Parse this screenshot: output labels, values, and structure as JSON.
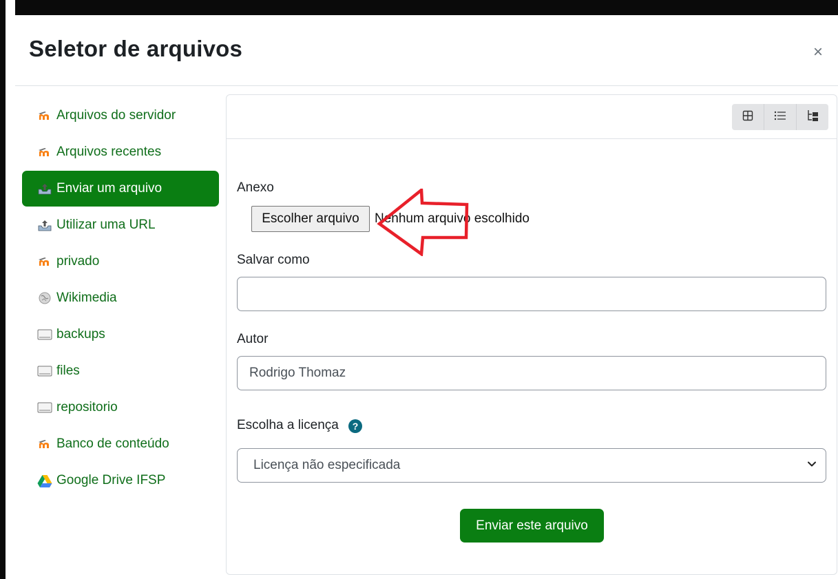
{
  "modal": {
    "title": "Seletor de arquivos",
    "close_label": "×"
  },
  "sidebar": {
    "items": [
      {
        "label": "Arquivos do servidor",
        "icon": "moodle-icon",
        "active": false
      },
      {
        "label": "Arquivos recentes",
        "icon": "moodle-icon",
        "active": false
      },
      {
        "label": "Enviar um arquivo",
        "icon": "upload-icon",
        "active": true
      },
      {
        "label": "Utilizar uma URL",
        "icon": "url-icon",
        "active": false
      },
      {
        "label": "privado",
        "icon": "moodle-icon",
        "active": false
      },
      {
        "label": "Wikimedia",
        "icon": "wikimedia-icon",
        "active": false
      },
      {
        "label": "backups",
        "icon": "folder-drive-icon",
        "active": false
      },
      {
        "label": "files",
        "icon": "folder-drive-icon",
        "active": false
      },
      {
        "label": "repositorio",
        "icon": "folder-drive-icon",
        "active": false
      },
      {
        "label": "Banco de conteúdo",
        "icon": "moodle-icon",
        "active": false
      },
      {
        "label": "Google Drive IFSP",
        "icon": "google-drive-icon",
        "active": false
      }
    ]
  },
  "toolbar": {
    "views": [
      "grid-view-icon",
      "list-view-icon",
      "tree-view-icon"
    ]
  },
  "form": {
    "attachment_label": "Anexo",
    "choose_button": "Escolher arquivo",
    "no_file_text": "Nenhum arquivo escolhido",
    "save_as_label": "Salvar como",
    "save_as_value": "",
    "author_label": "Autor",
    "author_value": "Rodrigo Thomaz",
    "license_label": "Escolha a licença",
    "license_selected": "Licença não especificada",
    "submit_button": "Enviar este arquivo"
  },
  "colors": {
    "accent": "#0a7e12",
    "link": "#0f6e1a",
    "help": "#0b6a80",
    "annotation_arrow": "#e8202a"
  }
}
